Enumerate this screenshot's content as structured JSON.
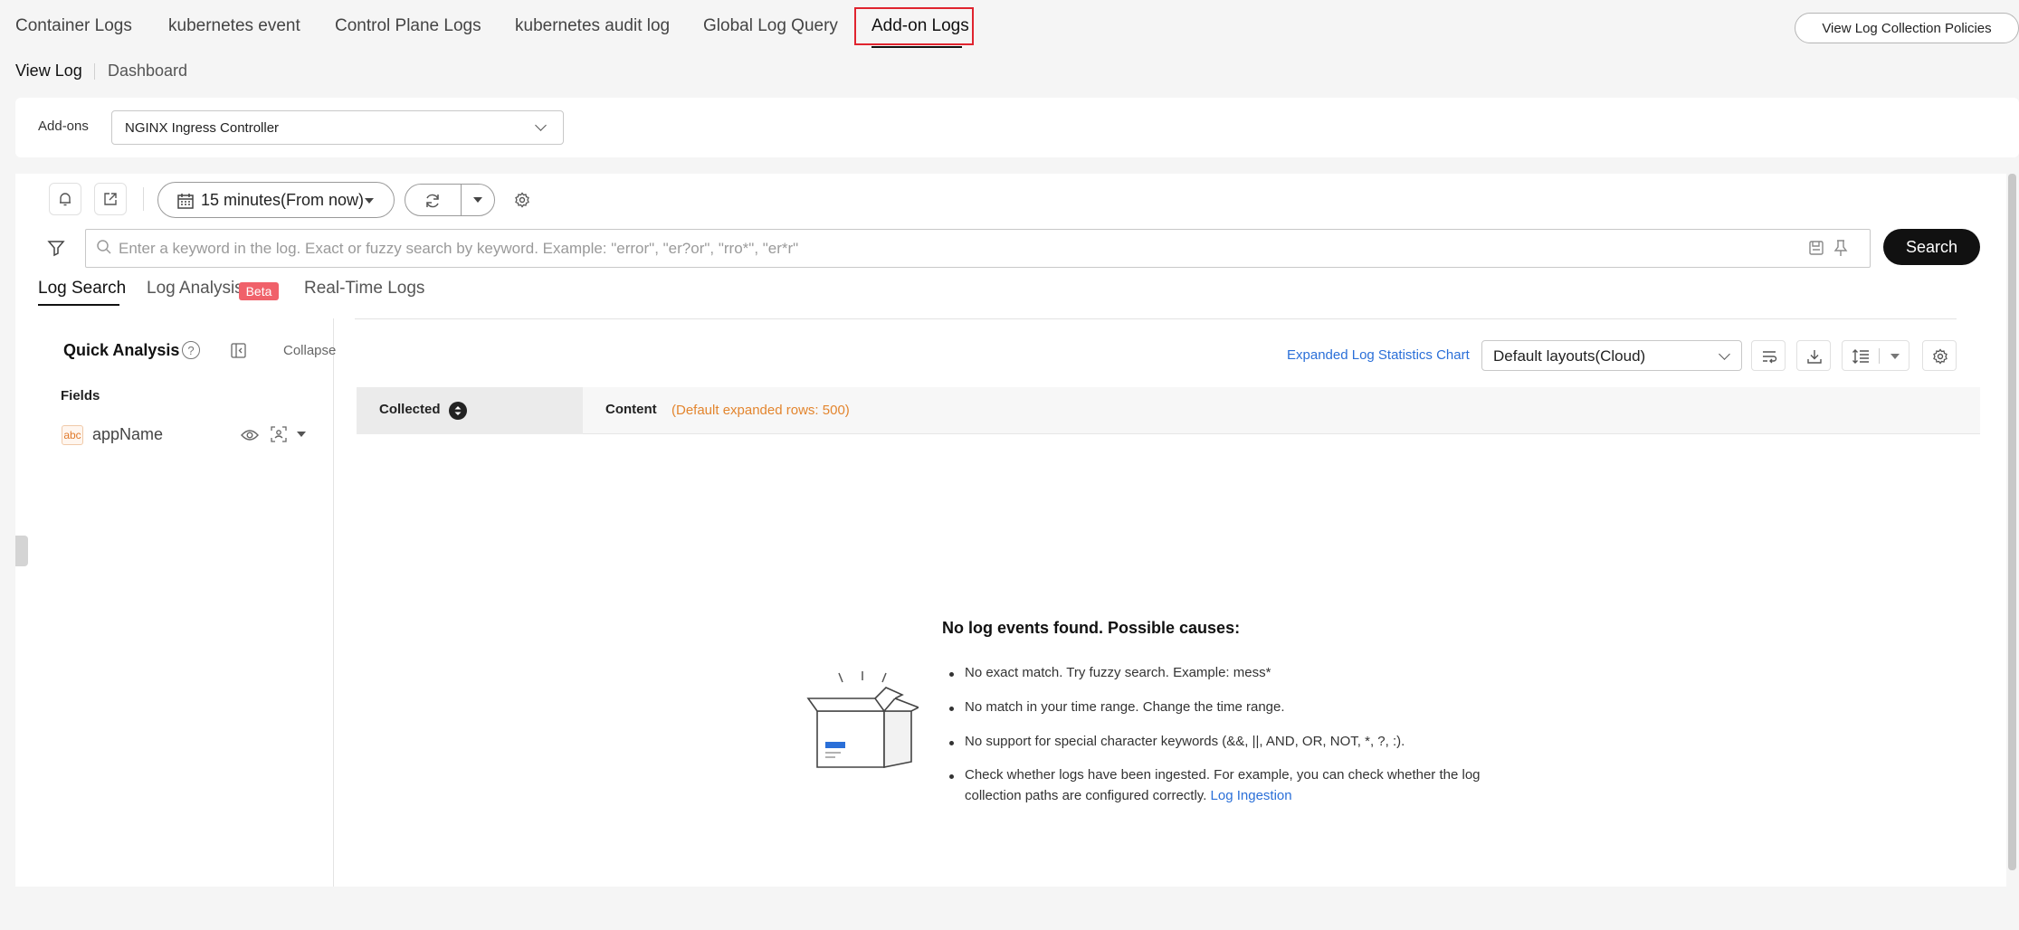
{
  "top_tabs": [
    "Container Logs",
    "kubernetes event",
    "Control Plane Logs",
    "kubernetes audit log",
    "Global Log Query",
    "Add-on Logs"
  ],
  "view_policies_label": "View Log Collection Policies",
  "sub_tabs": [
    "View Log",
    "Dashboard"
  ],
  "addons": {
    "label": "Add-ons",
    "selected": "NGINX Ingress Controller"
  },
  "toolbar": {
    "time_range": "15 minutes(From now)"
  },
  "search": {
    "placeholder": "Enter a keyword in the log. Exact or fuzzy search by keyword. Example: \"error\", \"er?or\", \"rro*\", \"er*r\"",
    "button": "Search"
  },
  "log_tabs": {
    "search": "Log Search",
    "analysis": "Log Analysis",
    "beta": "Beta",
    "realtime": "Real-Time Logs"
  },
  "quick_analysis": {
    "title": "Quick Analysis",
    "collapse": "Collapse",
    "fields_label": "Fields",
    "field_type": "abc",
    "field_name": "appName"
  },
  "results": {
    "stats_link": "Expanded Log Statistics Chart",
    "layout": "Default layouts(Cloud)",
    "col_collected": "Collected",
    "col_content": "Content",
    "expanded_note": "(Default expanded rows: 500)"
  },
  "empty": {
    "title": "No log events found. Possible causes:",
    "cause1": "No exact match. Try fuzzy search. Example: mess*",
    "cause2": "No match in your time range. Change the time range.",
    "cause3": "No support for special character keywords (&&, ||, AND, OR, NOT, *, ?, :).",
    "cause4_line1": "Check whether logs have been ingested. For example, you can check whether the log",
    "cause4_line2": "collection paths are configured correctly.",
    "cause4_link": "Log Ingestion"
  },
  "colors": {
    "accent": "#2a6fd8",
    "highlight_box": "#e0242f",
    "beta_badge": "#f0616a",
    "note_orange": "#e3852e"
  }
}
